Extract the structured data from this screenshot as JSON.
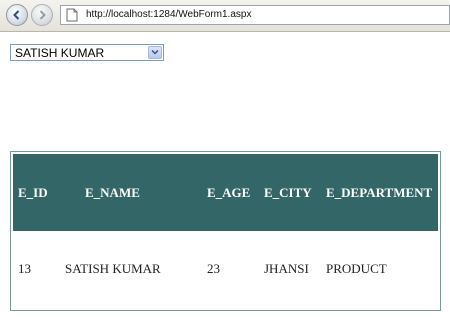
{
  "browser": {
    "url": "http://localhost:1284/WebForm1.aspx"
  },
  "employee_select": {
    "selected": "SATISH KUMAR"
  },
  "grid": {
    "headers": [
      "E_ID",
      "E_NAME",
      "E_AGE",
      "E_CITY",
      "E_DEPARTMENT"
    ],
    "rows": [
      [
        "13",
        "SATISH KUMAR",
        "23",
        "JHANSI",
        "PRODUCT"
      ]
    ],
    "header_color": "#336666"
  }
}
